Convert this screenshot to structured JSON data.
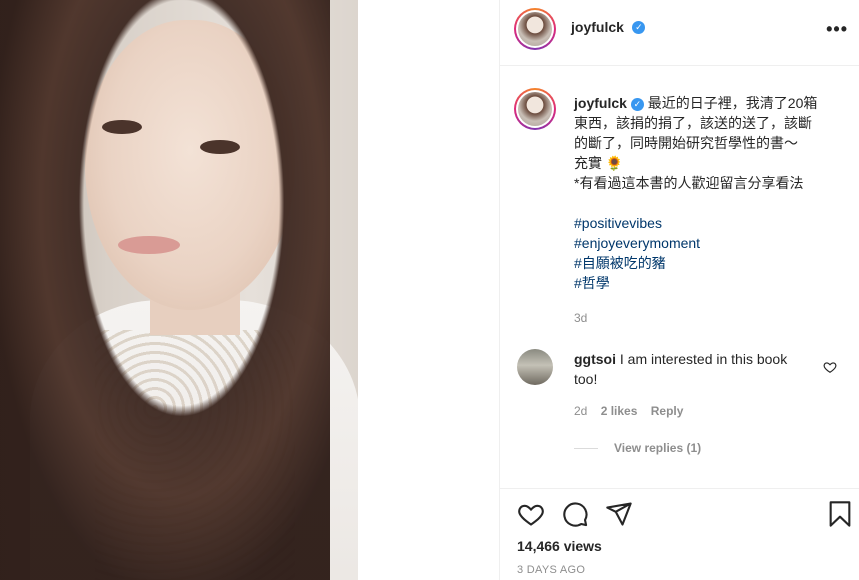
{
  "post": {
    "username": "joyfulck",
    "more_label": "•••",
    "caption_lines": [
      "最近的日子裡，我清了20箱",
      "東西，該捐的捐了，該送的送了，該斷",
      "的斷了，同時開始研究哲學性的書～",
      "充實 🌻",
      "*有看過這本書的人歡迎留言分享看法"
    ],
    "hashtags": [
      "#positivevibes",
      "#enjoyeverymoment",
      "#自願被吃的豬",
      "#哲學"
    ],
    "caption_time": "3d",
    "views": "14,466 views",
    "date": "3 DAYS AGO"
  },
  "comment": {
    "username": "ggtsoi",
    "text": "I am interested in this book too!",
    "time": "2d",
    "likes": "2 likes",
    "reply_label": "Reply",
    "view_replies": "View replies (1)"
  },
  "icons": {
    "verified": "verified-badge-icon",
    "like": "heart-icon",
    "comment": "comment-icon",
    "share": "share-icon",
    "save": "bookmark-icon"
  },
  "colors": {
    "accent_link": "#00376b",
    "verified": "#3897f0",
    "muted": "#8e8e8e"
  }
}
